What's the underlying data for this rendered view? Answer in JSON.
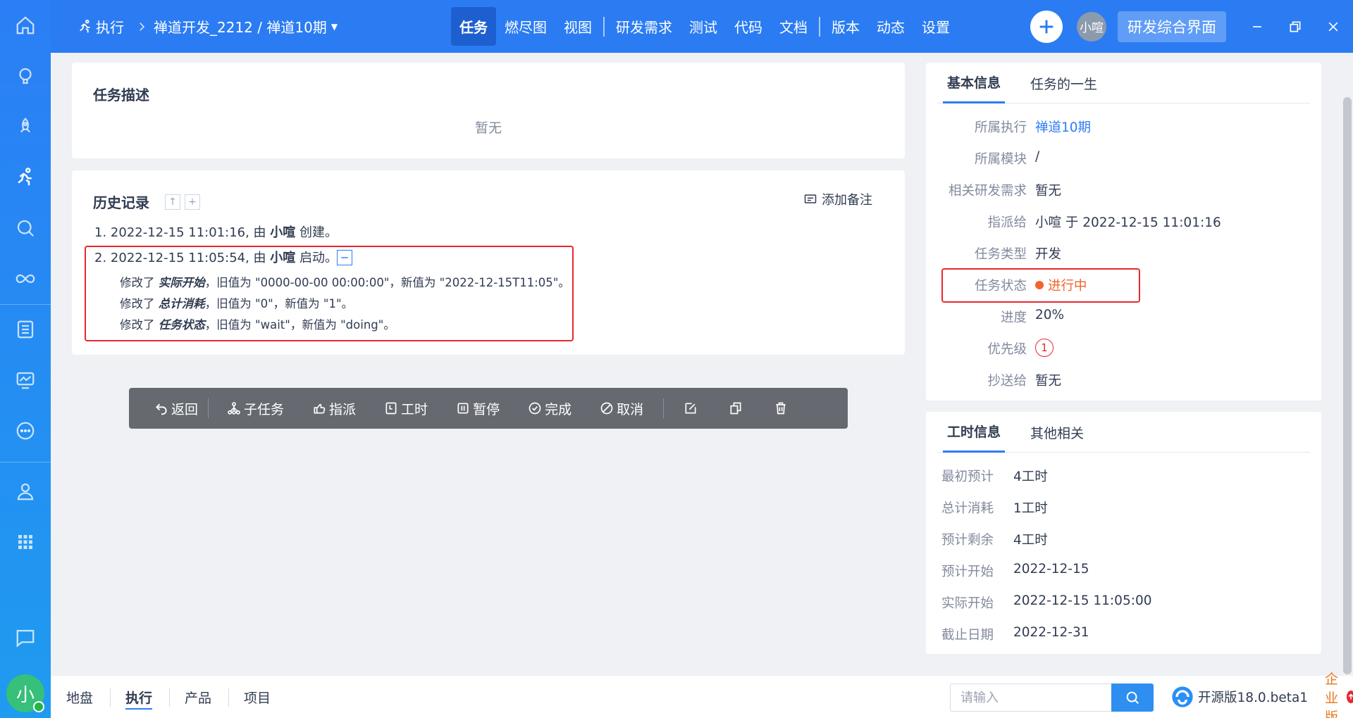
{
  "header": {
    "module": "执行",
    "breadcrumb": "禅道开发_2212 / 禅道10期",
    "nav": [
      "任务",
      "燃尽图",
      "视图",
      "研发需求",
      "测试",
      "代码",
      "文档",
      "版本",
      "动态",
      "设置"
    ],
    "user_short": "小喧",
    "portal_label": "研发综合界面"
  },
  "rail": {
    "icons": [
      "home-icon",
      "lightbulb-icon",
      "rocket-icon",
      "running-icon",
      "bug-search-icon",
      "infinity-icon",
      "list-icon",
      "monitor-icon",
      "more-icon",
      "user-icon",
      "apps-icon",
      "chat-icon"
    ],
    "avatar_text": "小"
  },
  "description": {
    "title": "任务描述",
    "empty": "暂无"
  },
  "history": {
    "title": "历史记录",
    "add_note": "添加备注",
    "entries": [
      {
        "num": "1.",
        "time": "2022-12-15 11:01:16",
        "by": "由",
        "user": "小喧",
        "action": "创建。"
      },
      {
        "num": "2.",
        "time": "2022-12-15 11:05:54",
        "by": "由",
        "user": "小喧",
        "action": "启动。"
      }
    ],
    "changes": [
      {
        "prefix": "修改了",
        "field": "实际开始",
        "rest": "，旧值为 \"0000-00-00 00:00:00\"，新值为 \"2022-12-15T11:05\"。"
      },
      {
        "prefix": "修改了",
        "field": "总计消耗",
        "rest": "，旧值为 \"0\"，新值为 \"1\"。"
      },
      {
        "prefix": "修改了",
        "field": "任务状态",
        "rest": "，旧值为 \"wait\"，新值为 \"doing\"。"
      }
    ]
  },
  "toolbar": {
    "back": "返回",
    "subtask": "子任务",
    "assign": "指派",
    "effort": "工时",
    "pause": "暂停",
    "finish": "完成",
    "cancel": "取消"
  },
  "basic": {
    "tabs": [
      "基本信息",
      "任务的一生"
    ],
    "rows": [
      {
        "label": "所属执行",
        "value": "禅道10期"
      },
      {
        "label": "所属模块",
        "value": "/"
      },
      {
        "label": "相关研发需求",
        "value": "暂无"
      },
      {
        "label": "指派给",
        "value": "小喧 于 2022-12-15 11:01:16"
      },
      {
        "label": "任务类型",
        "value": "开发"
      },
      {
        "label": "任务状态",
        "value": "进行中"
      },
      {
        "label": "进度",
        "value": "20%"
      },
      {
        "label": "优先级",
        "value": "1"
      },
      {
        "label": "抄送给",
        "value": "暂无"
      }
    ],
    "status_color": "#f1652c"
  },
  "effort": {
    "tabs": [
      "工时信息",
      "其他相关"
    ],
    "rows": [
      {
        "label": "最初预计",
        "value": "4工时"
      },
      {
        "label": "总计消耗",
        "value": "1工时"
      },
      {
        "label": "预计剩余",
        "value": "4工时"
      },
      {
        "label": "预计开始",
        "value": "2022-12-15"
      },
      {
        "label": "实际开始",
        "value": "2022-12-15 11:05:00"
      },
      {
        "label": "截止日期",
        "value": "2022-12-31"
      }
    ]
  },
  "bottom": {
    "tabs": [
      "地盘",
      "执行",
      "产品",
      "项目"
    ],
    "search_placeholder": "请输入",
    "version": "开源版18.0.beta1",
    "enterprise": "企业版"
  },
  "colors": {
    "accent": "#2b7cf3",
    "highlight": "#e8272d"
  }
}
